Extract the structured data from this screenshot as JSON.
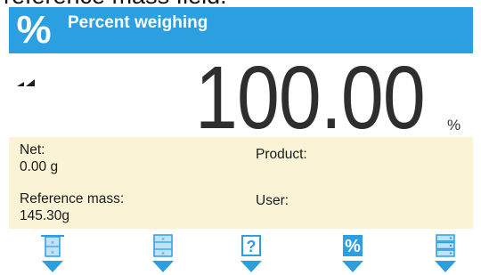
{
  "caption": "reference mass field.",
  "header": {
    "icon": "percent-icon",
    "icon_glyph": "%",
    "title": "Percent weighing",
    "background_color": "#2b9fe0"
  },
  "display": {
    "stability_icon": "stability-marker-icon",
    "reading": "100.00",
    "unit": "%"
  },
  "info": {
    "background_color": "#faf3d6",
    "net_label": "Net:",
    "net_value": "0.00 g",
    "product_label": "Product:",
    "reference_mass_label": "Reference mass:",
    "reference_mass_value": "145.30g",
    "user_label": "User:"
  },
  "toolbar": {
    "accent_color": "#2b9fe0",
    "buttons": [
      {
        "icon": "sample-weigh-icon"
      },
      {
        "icon": "reference-mass-icon"
      },
      {
        "icon": "help-icon",
        "glyph": "?"
      },
      {
        "icon": "percent-icon",
        "glyph": "%"
      },
      {
        "icon": "database-icon"
      }
    ]
  }
}
